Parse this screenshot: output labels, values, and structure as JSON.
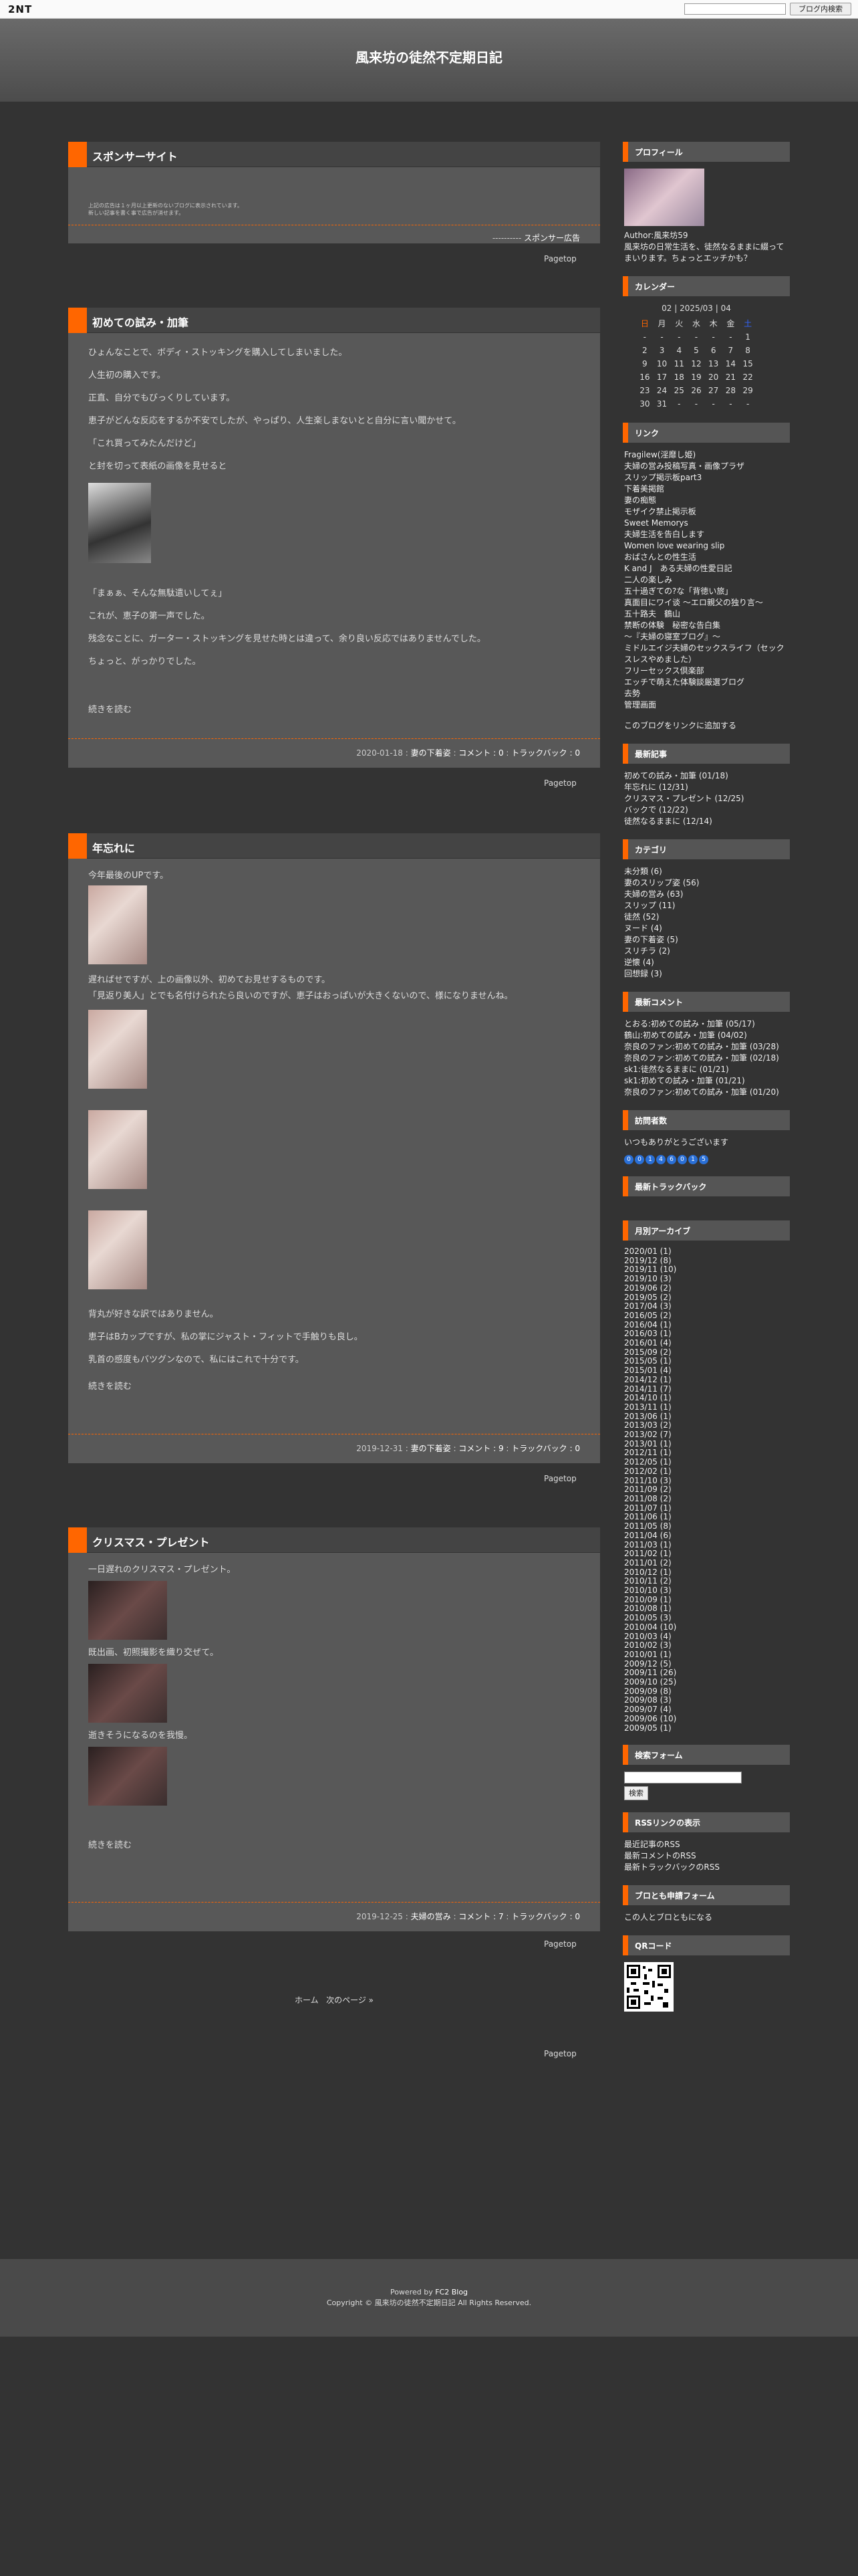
{
  "topbar": {
    "logo": "2NT",
    "search_placeholder": "",
    "search_button": "ブログ内検索"
  },
  "site_title": "風来坊の徒然不定期日記",
  "sponsor": {
    "title": "スポンサーサイト",
    "line1": "上記の広告は１ヶ月以上更新のないブログに表示されています。",
    "line2": "新しい記事を書く事で広告が消せます。",
    "foot": "----------",
    "ad_label": "スポンサー広告"
  },
  "pagetop": "Pagetop",
  "entries": [
    {
      "title": "初めての試み・加筆",
      "paras": [
        "ひょんなことで、ボディ・ストッキングを購入してしまいました。",
        "人生初の購入です。",
        "正直、自分でもびっくりしています。",
        "恵子がどんな反応をするか不安でしたが、やっぱり、人生楽しまないとと自分に言い聞かせて。",
        "「これ買ってみたんだけど」",
        "と封を切って表紙の画像を見せると",
        "「まぁぁ、そんな無駄遣いしてぇ」",
        "これが、恵子の第一声でした。",
        "残念なことに、ガーター・ストッキングを見せた時とは違って、余り良い反応ではありませんでした。",
        "ちょっと、がっかりでした。"
      ],
      "more": "続きを読む",
      "date": "2020-01-18",
      "cat": "妻の下着姿",
      "comment": "コメント : 0",
      "tb": "トラックバック : 0"
    },
    {
      "title": "年忘れに",
      "paras": [
        "今年最後のUPです。",
        "遅ればせですが、上の画像以外、初めてお見せするものです。",
        "「見返り美人」とでも名付けられたら良いのですが、恵子はおっぱいが大きくないので、様になりませんね。",
        "背丸が好きな訳ではありません。",
        "恵子はBカップですが、私の掌にジャスト・フィットで手触りも良し。",
        "乳首の感度もバツグンなので、私にはこれで十分です。"
      ],
      "more": "続きを読む",
      "date": "2019-12-31",
      "cat": "妻の下着姿",
      "comment": "コメント : 9",
      "tb": "トラックバック : 0"
    },
    {
      "title": "クリスマス・プレゼント",
      "paras": [
        "一日遅れのクリスマス・プレゼント。",
        "既出画、初照撮影を織り交ぜて。",
        "逝きそうになるのを我慢。"
      ],
      "more": "続きを読む",
      "date": "2019-12-25",
      "cat": "夫婦の営み",
      "comment": "コメント : 7",
      "tb": "トラックバック : 0"
    }
  ],
  "pager": {
    "home": "ホーム",
    "next": "次のページ »"
  },
  "sidebar": {
    "profile": {
      "h": "プロフィール",
      "author": "Author:風来坊59",
      "desc": "風来坊の日常生活を、徒然なるままに綴ってまいります。ちょっとエッチかも？"
    },
    "calendar": {
      "h": "カレンダー",
      "prev": "02",
      "cur": "2025/03",
      "next": "04",
      "dow": [
        "日",
        "月",
        "火",
        "水",
        "木",
        "金",
        "土"
      ],
      "rows": [
        [
          "-",
          "-",
          "-",
          "-",
          "-",
          "-",
          "1"
        ],
        [
          "2",
          "3",
          "4",
          "5",
          "6",
          "7",
          "8"
        ],
        [
          "9",
          "10",
          "11",
          "12",
          "13",
          "14",
          "15"
        ],
        [
          "16",
          "17",
          "18",
          "19",
          "20",
          "21",
          "22"
        ],
        [
          "23",
          "24",
          "25",
          "26",
          "27",
          "28",
          "29"
        ],
        [
          "30",
          "31",
          "-",
          "-",
          "-",
          "-",
          "-"
        ]
      ]
    },
    "links": {
      "h": "リンク",
      "items": [
        "Fragilew(淫靡し姫)",
        "夫婦の営み投稿写真・画像プラザ",
        "スリップ掲示板part3",
        "下着美掲館",
        "妻の痴態",
        "モザイク禁止掲示板",
        "Sweet Memorys",
        "夫婦生活を告白します",
        "Women love wearing slip",
        "おばさんとの性生活",
        "K and J　ある夫婦の性愛日記",
        "二人の楽しみ",
        "五十過ぎての?な「背徳い旅」",
        "真面目にワイ谈 ～エロ親父の独り言～",
        "五十路夫　鶴山",
        "禁断の体験　秘密な告白集",
        "～『夫婦の寝室ブログ』～",
        "ミドルエイジ夫婦のセックスライフ（セックスレスやめました）",
        "フリーセックス倶楽部",
        "エッチで萌えた体験談厳選ブログ",
        "去勢",
        "管理画面"
      ],
      "add": "このブログをリンクに追加する"
    },
    "recent": {
      "h": "最新記事",
      "items": [
        "初めての試み・加筆 (01/18)",
        "年忘れに (12/31)",
        "クリスマス・プレゼント (12/25)",
        "バックで (12/22)",
        "徒然なるままに (12/14)"
      ]
    },
    "category": {
      "h": "カテゴリ",
      "items": [
        "未分類 (6)",
        "妻のスリップ姿 (56)",
        "夫婦の営み (63)",
        "スリップ (11)",
        "徒然 (52)",
        "ヌード (4)",
        "妻の下着姿 (5)",
        "スリチラ (2)",
        "逆懐 (4)",
        "回想録 (3)"
      ]
    },
    "comments": {
      "h": "最新コメント",
      "items": [
        "とおる:初めての試み・加筆 (05/17)",
        "鶴山:初めての試み・加筆 (04/02)",
        "奈良のファン:初めての試み・加筆 (03/28)",
        "奈良のファン:初めての試み・加筆 (02/18)",
        "sk1:徒然なるままに (01/21)",
        "sk1:初めての試み・加筆 (01/21)",
        "奈良のファン:初めての試み・加筆 (01/20)"
      ]
    },
    "counter": {
      "h": "訪問者数",
      "text": "いつもありがとうございます",
      "digits": [
        "0",
        "0",
        "1",
        "4",
        "6",
        "0",
        "1",
        "5"
      ]
    },
    "trackback": {
      "h": "最新トラックバック"
    },
    "archive": {
      "h": "月別アーカイブ",
      "items": [
        "2020/01 (1)",
        "2019/12 (8)",
        "2019/11 (10)",
        "2019/10 (3)",
        "2019/06 (2)",
        "2019/05 (2)",
        "2017/04 (3)",
        "2016/05 (2)",
        "2016/04 (1)",
        "2016/03 (1)",
        "2016/01 (4)",
        "2015/09 (2)",
        "2015/05 (1)",
        "2015/01 (4)",
        "2014/12 (1)",
        "2014/11 (7)",
        "2014/10 (1)",
        "2013/11 (1)",
        "2013/06 (1)",
        "2013/03 (2)",
        "2013/02 (7)",
        "2013/01 (1)",
        "2012/11 (1)",
        "2012/05 (1)",
        "2012/02 (1)",
        "2011/10 (3)",
        "2011/09 (2)",
        "2011/08 (2)",
        "2011/07 (1)",
        "2011/06 (1)",
        "2011/05 (8)",
        "2011/04 (6)",
        "2011/03 (1)",
        "2011/02 (1)",
        "2011/01 (2)",
        "2010/12 (1)",
        "2010/11 (2)",
        "2010/10 (3)",
        "2010/09 (1)",
        "2010/08 (1)",
        "2010/05 (3)",
        "2010/04 (10)",
        "2010/03 (4)",
        "2010/02 (3)",
        "2010/01 (1)",
        "2009/12 (5)",
        "2009/11 (26)",
        "2009/10 (25)",
        "2009/09 (8)",
        "2009/08 (3)",
        "2009/07 (4)",
        "2009/06 (10)",
        "2009/05 (1)"
      ]
    },
    "search": {
      "h": "検索フォーム",
      "button": "検索"
    },
    "rss": {
      "h": "RSSリンクの表示",
      "items": [
        "最近記事のRSS",
        "最新コメントのRSS",
        "最新トラックバックのRSS"
      ]
    },
    "friend": {
      "h": "ブロとも申請フォーム",
      "link": "この人とブロともになる"
    },
    "qr": {
      "h": "QRコード"
    }
  },
  "footer": {
    "powered": "Powered by",
    "fc2": "FC2 Blog",
    "copyright": "Copyright © 風来坊の徒然不定期日記 All Rights Reserved."
  },
  "colors": {
    "accent": "#ff6600",
    "bg": "#333333",
    "panel": "#585858"
  }
}
